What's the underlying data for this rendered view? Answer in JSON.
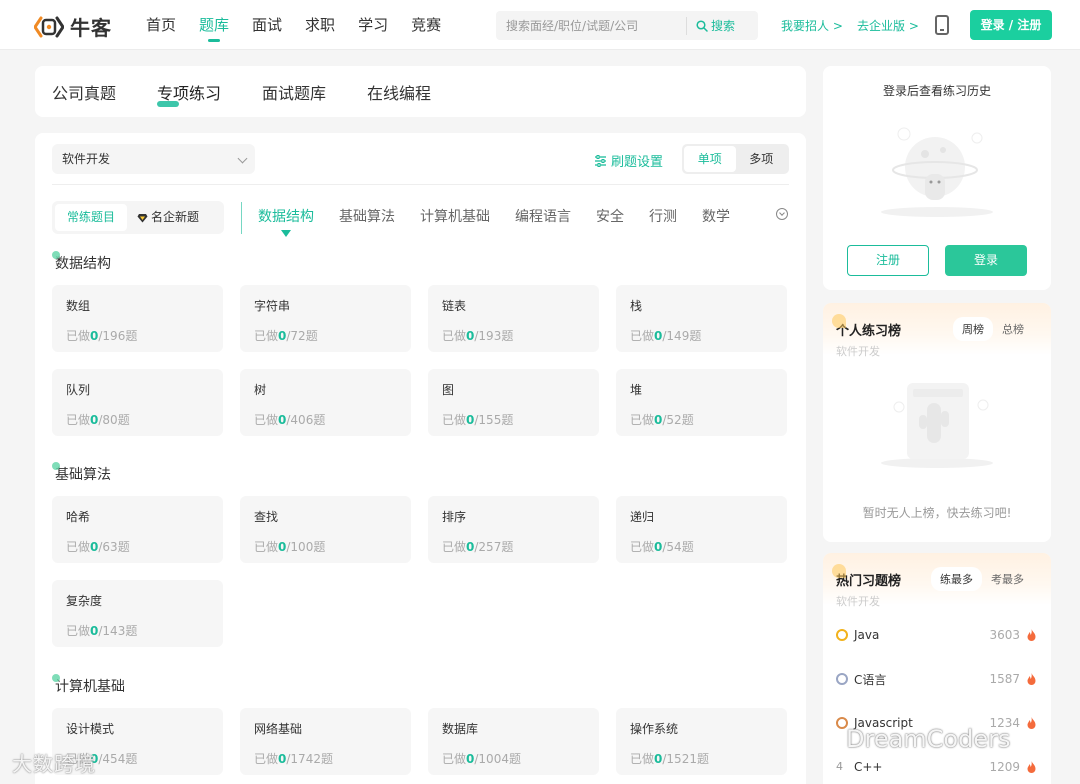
{
  "header": {
    "logo_text": "牛客",
    "nav": [
      "首页",
      "题库",
      "面试",
      "求职",
      "学习",
      "竞赛"
    ],
    "active_nav": 1,
    "search_placeholder": "搜索面经/职位/试题/公司",
    "search_button": "搜索",
    "hire_link": "我要招人 >",
    "enterprise_link": "去企业版 >",
    "login_button": "登录 / 注册"
  },
  "main_tabs": [
    "公司真题",
    "专项练习",
    "面试题库",
    "在线编程"
  ],
  "active_main_tab": 1,
  "filter": {
    "category": "软件开发",
    "settings_label": "刷题设置",
    "modes": [
      "单项",
      "多项"
    ],
    "active_mode": 0,
    "types": [
      "常练题目",
      "名企新题"
    ],
    "active_type": 0,
    "subtabs": [
      "数据结构",
      "基础算法",
      "计算机基础",
      "编程语言",
      "安全",
      "行测",
      "数学"
    ],
    "active_subtab": 0
  },
  "done_prefix": "已做",
  "done_suffix": "题",
  "sections": [
    {
      "title": "数据结构",
      "tiles": [
        {
          "name": "数组",
          "done": "0",
          "total": "196"
        },
        {
          "name": "字符串",
          "done": "0",
          "total": "72"
        },
        {
          "name": "链表",
          "done": "0",
          "total": "193"
        },
        {
          "name": "栈",
          "done": "0",
          "total": "149"
        },
        {
          "name": "队列",
          "done": "0",
          "total": "80"
        },
        {
          "name": "树",
          "done": "0",
          "total": "406"
        },
        {
          "name": "图",
          "done": "0",
          "total": "155"
        },
        {
          "name": "堆",
          "done": "0",
          "total": "52"
        }
      ]
    },
    {
      "title": "基础算法",
      "tiles": [
        {
          "name": "哈希",
          "done": "0",
          "total": "63"
        },
        {
          "name": "查找",
          "done": "0",
          "total": "100"
        },
        {
          "name": "排序",
          "done": "0",
          "total": "257"
        },
        {
          "name": "递归",
          "done": "0",
          "total": "54"
        },
        {
          "name": "复杂度",
          "done": "0",
          "total": "143"
        }
      ]
    },
    {
      "title": "计算机基础",
      "tiles": [
        {
          "name": "设计模式",
          "done": "0",
          "total": "454"
        },
        {
          "name": "网络基础",
          "done": "0",
          "total": "1742"
        },
        {
          "name": "数据库",
          "done": "0",
          "total": "1004"
        },
        {
          "name": "操作系统",
          "done": "0",
          "total": "1521"
        }
      ]
    }
  ],
  "sidebar": {
    "login_prompt": "登录后查看练习历史",
    "register_button": "注册",
    "login_button": "登录",
    "personal_rank": {
      "title": "个人练习榜",
      "subtitle": "软件开发",
      "tabs": [
        "周榜",
        "总榜"
      ],
      "active_tab": 0,
      "empty_text": "暂时无人上榜，快去练习吧!"
    },
    "hot_rank": {
      "title": "热门习题榜",
      "subtitle": "软件开发",
      "tabs": [
        "练最多",
        "考最多"
      ],
      "active_tab": 0,
      "items": [
        {
          "rank_icon": "gold-medal-icon",
          "name": "Java",
          "count": "3603"
        },
        {
          "rank_icon": "silver-medal-icon",
          "name": "C语言",
          "count": "1587"
        },
        {
          "rank_icon": "bronze-medal-icon",
          "name": "Javascript",
          "count": "1234"
        },
        {
          "rank_icon": "rank-4",
          "name": "C++",
          "count": "1209"
        }
      ]
    }
  },
  "watermarks": [
    "大数跨境",
    "DreamCoders"
  ],
  "colors": {
    "brand": "#1bbc9b",
    "button": "#1bcf9f",
    "fire": "#f46b3c"
  }
}
